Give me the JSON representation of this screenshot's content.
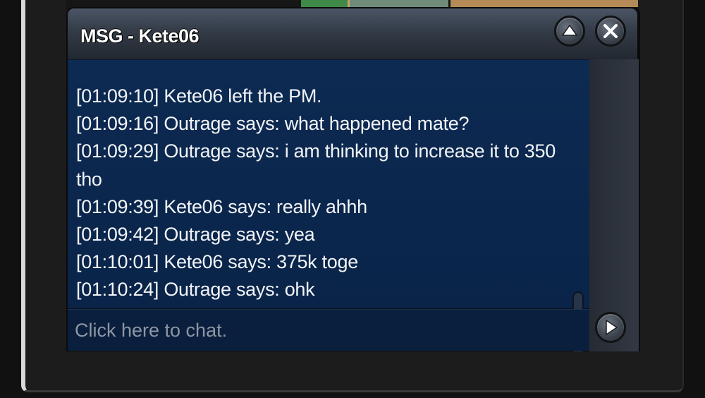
{
  "window": {
    "title": "MSG - Kete06",
    "minimize_icon": "chevron-up-icon",
    "close_icon": "close-icon"
  },
  "messages": [
    {
      "time": "[01:09:10]",
      "text": "Kete06 left the PM."
    },
    {
      "time": "[01:09:16]",
      "text": "Outrage says: what happened mate?"
    },
    {
      "time": "[01:09:29]",
      "text": "Outrage says: i am thinking to increase it to 350 tho"
    },
    {
      "time": "[01:09:39]",
      "text": "Kete06 says: really ahhh"
    },
    {
      "time": "[01:09:42]",
      "text": "Outrage says: yea"
    },
    {
      "time": "[01:10:01]",
      "text": "Kete06 says: 375k toge"
    },
    {
      "time": "[01:10:24]",
      "text": "Outrage says: ohk"
    }
  ],
  "input": {
    "placeholder": "Click here to chat.",
    "value": "",
    "send_icon": "play-arrow-icon"
  },
  "colors": {
    "message_bg": "#0d2a52",
    "title_bar": "#3a4250",
    "text": "#f2f4f7"
  }
}
